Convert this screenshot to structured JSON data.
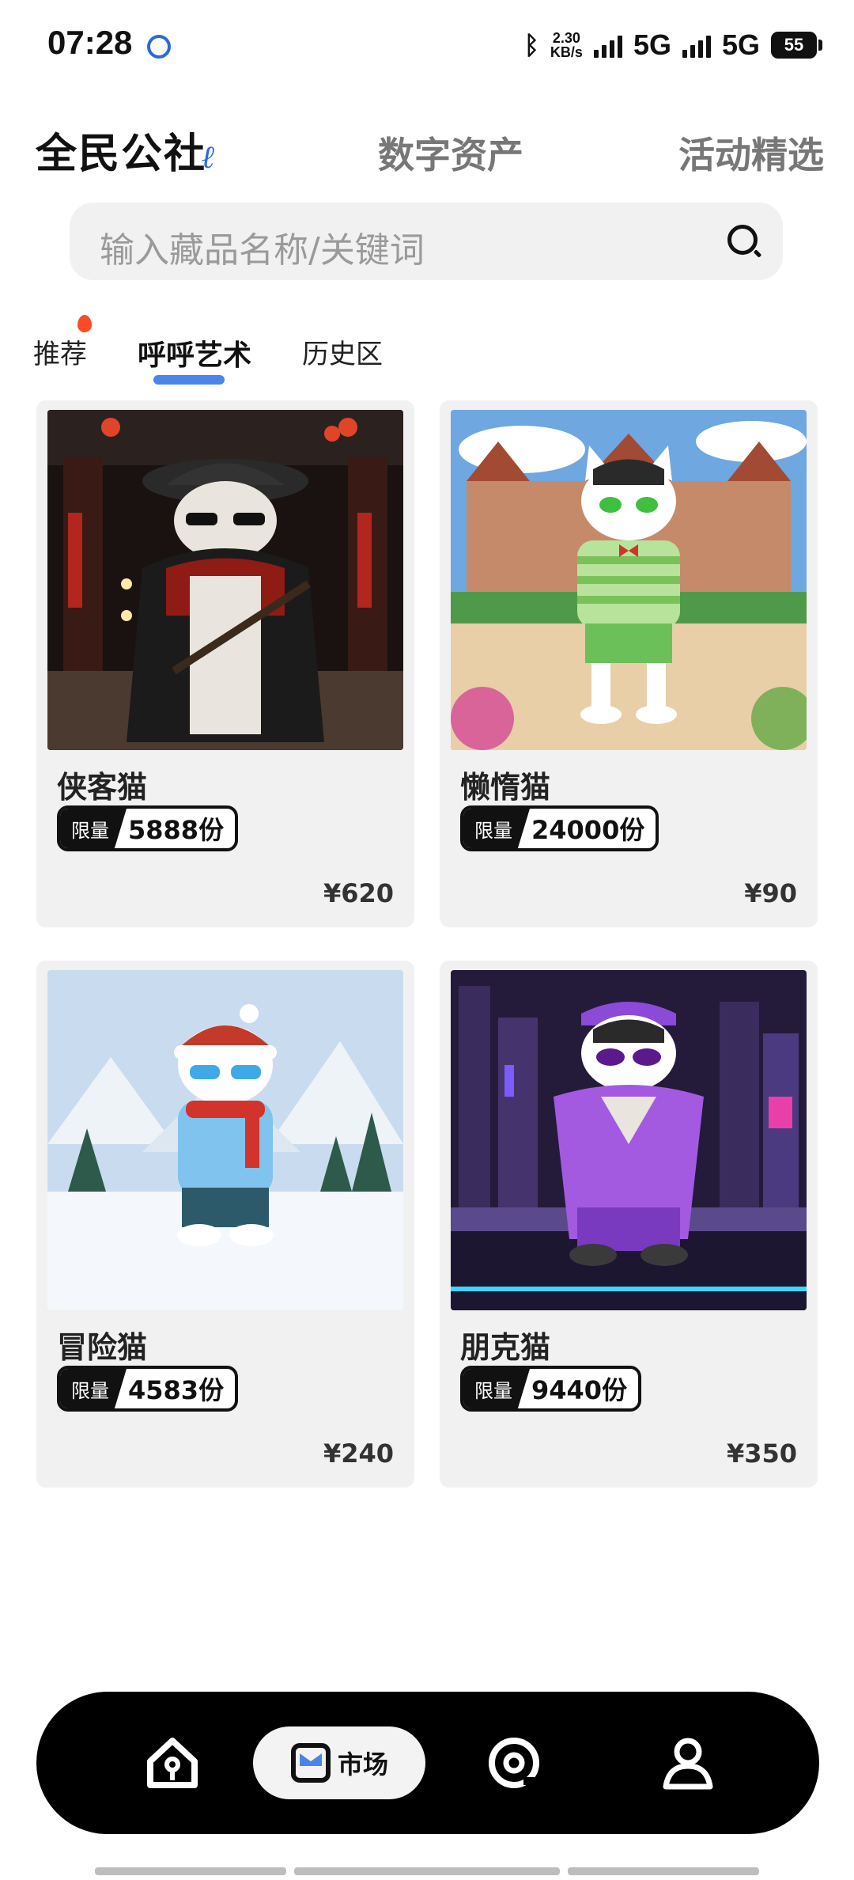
{
  "status_bar": {
    "time": "07:28",
    "speed_top": "2.30",
    "speed_bottom": "KB/s",
    "network_1": "5G",
    "network_2": "5G",
    "battery": "55"
  },
  "header": {
    "logo": "全民公社",
    "tabs": [
      "数字资产",
      "活动精选"
    ]
  },
  "search": {
    "placeholder": "输入藏品名称/关键词"
  },
  "sub_tabs": [
    {
      "label": "推荐",
      "hot": true
    },
    {
      "label": "呼呼艺术",
      "active": true
    },
    {
      "label": "历史区"
    }
  ],
  "items": [
    {
      "name": "侠客猫",
      "limit_label": "限量",
      "quantity": "5888份",
      "price": "¥620"
    },
    {
      "name": "懒惰猫",
      "limit_label": "限量",
      "quantity": "24000份",
      "price": "¥90"
    },
    {
      "name": "冒险猫",
      "limit_label": "限量",
      "quantity": "4583份",
      "price": "¥240"
    },
    {
      "name": "朋克猫",
      "limit_label": "限量",
      "quantity": "9440份",
      "price": "¥350"
    }
  ],
  "bottom_nav": {
    "home_icon": "home-icon",
    "market_label": "市场",
    "discover_icon": "discover-icon",
    "profile_icon": "profile-icon"
  },
  "colors": {
    "accent": "#4a86e8",
    "card_bg": "#f1f1f1",
    "nav_bg": "#000000"
  }
}
